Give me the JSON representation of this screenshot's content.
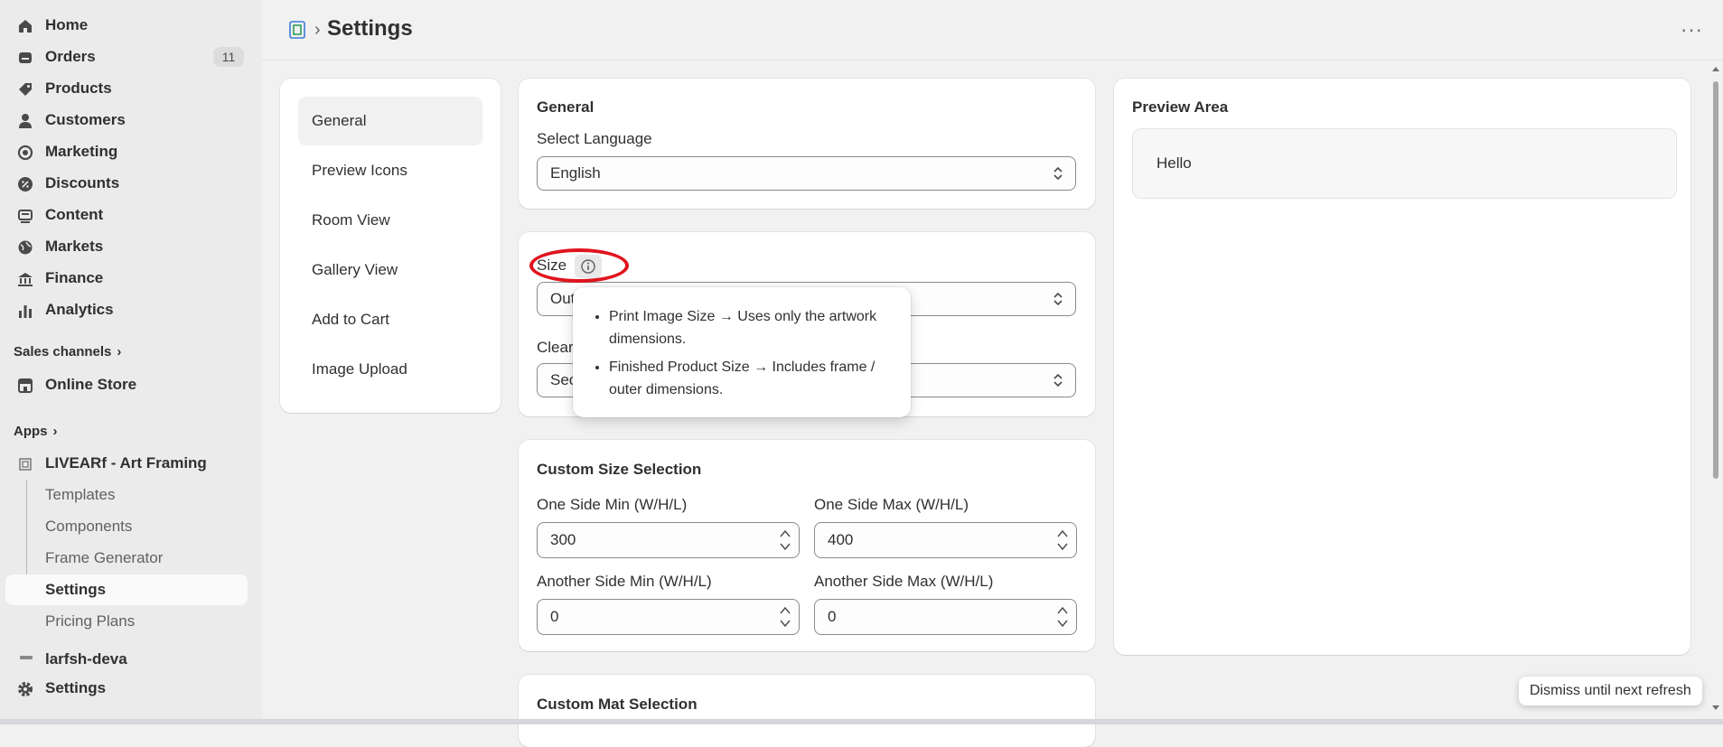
{
  "sidebar": {
    "nav": [
      {
        "label": "Home",
        "icon": "home-icon"
      },
      {
        "label": "Orders",
        "icon": "orders-icon",
        "count": "11"
      },
      {
        "label": "Products",
        "icon": "tag-icon"
      },
      {
        "label": "Customers",
        "icon": "person-icon"
      },
      {
        "label": "Marketing",
        "icon": "target-icon"
      },
      {
        "label": "Discounts",
        "icon": "discount-icon"
      },
      {
        "label": "Content",
        "icon": "content-icon"
      },
      {
        "label": "Markets",
        "icon": "globe-icon"
      },
      {
        "label": "Finance",
        "icon": "bank-icon"
      },
      {
        "label": "Analytics",
        "icon": "bar-chart-icon"
      }
    ],
    "sales_channels_label": "Sales channels",
    "online_store_label": "Online Store",
    "apps_label": "Apps",
    "app_name": "LIVEARf - Art Framing",
    "app_sub_items": [
      "Templates",
      "Components",
      "Frame Generator",
      "Settings",
      "Pricing Plans"
    ],
    "truncated_item": "larfsh-deva",
    "settings_label": "Settings"
  },
  "header": {
    "title": "Settings",
    "breadcrumb_sep": "›",
    "more_label": "···"
  },
  "settings_menu": [
    "General",
    "Preview Icons",
    "Room View",
    "Gallery View",
    "Add to Cart",
    "Image Upload"
  ],
  "general_card": {
    "title": "General",
    "language_label": "Select Language",
    "language_value": "English"
  },
  "size_card": {
    "size_label": "Size",
    "size_value": "Out",
    "clearance_label": "Clear",
    "clearance_value": "Sec"
  },
  "tooltip": {
    "items": [
      "Print Image Size → Uses only the artwork dimensions.",
      "Finished Product Size → Includes frame / outer dimensions."
    ]
  },
  "custom_size": {
    "title": "Custom Size Selection",
    "one_min_label": "One Side Min (W/H/L)",
    "one_min_value": "300",
    "one_max_label": "One Side Max (W/H/L)",
    "one_max_value": "400",
    "another_min_label": "Another Side Min (W/H/L)",
    "another_min_value": "0",
    "another_max_label": "Another Side Max (W/H/L)",
    "another_max_value": "0"
  },
  "custom_mat": {
    "title": "Custom Mat Selection"
  },
  "preview": {
    "title": "Preview Area",
    "text": "Hello"
  },
  "dismiss_label": "Dismiss until next refresh"
}
